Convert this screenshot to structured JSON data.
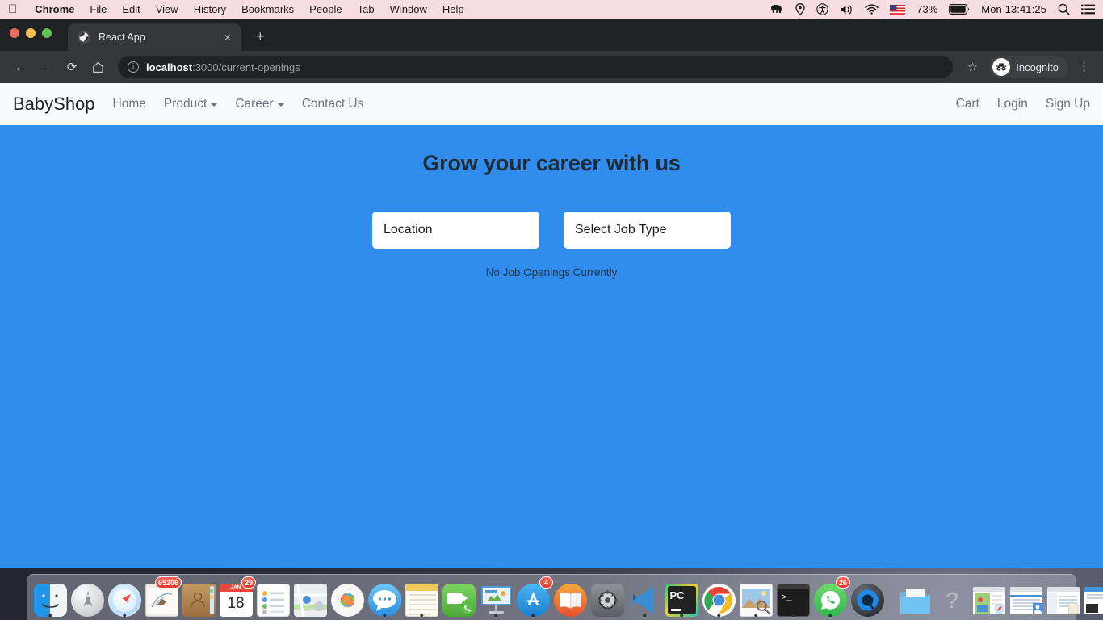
{
  "menubar": {
    "apple_icon": "apple-logo",
    "items": [
      {
        "label": "Chrome",
        "bold": true
      },
      {
        "label": "File",
        "bold": false
      },
      {
        "label": "Edit",
        "bold": false
      },
      {
        "label": "View",
        "bold": false
      },
      {
        "label": "History",
        "bold": false
      },
      {
        "label": "Bookmarks",
        "bold": false
      },
      {
        "label": "People",
        "bold": false
      },
      {
        "label": "Tab",
        "bold": false
      },
      {
        "label": "Window",
        "bold": false
      },
      {
        "label": "Help",
        "bold": false
      }
    ],
    "status_icons": [
      "elephant-icon",
      "location-pin-icon",
      "accessibility-icon",
      "volume-icon",
      "wifi-icon",
      "us-flag-icon"
    ],
    "battery_percent": "73%",
    "battery_icon": "battery-icon",
    "clock": "Mon 13:41:25",
    "spotlight_icon": "search-icon",
    "control_center_icon": "list-menu-icon",
    "background_color": "#f6dde3"
  },
  "browser": {
    "window_controls": [
      "close-button",
      "minimize-button",
      "maximize-button"
    ],
    "tab": {
      "title": "React App",
      "favicon": "globe-icon",
      "close_label": "×"
    },
    "new_tab_label": "+",
    "toolbar": {
      "back_label": "←",
      "forward_label": "→",
      "reload_label": "⟳",
      "home_label": "⌂",
      "site_info_label": "i",
      "url_host": "localhost",
      "url_rest": ":3000/current-openings",
      "bookmark_label": "☆",
      "profile_label": "Incognito",
      "profile_icon": "incognito-icon",
      "menu_label": "⋮"
    }
  },
  "page": {
    "navbar": {
      "brand": "BabyShop",
      "links": [
        {
          "label": "Home",
          "caret": false
        },
        {
          "label": "Product",
          "caret": true
        },
        {
          "label": "Career",
          "caret": true
        },
        {
          "label": "Contact Us",
          "caret": false
        }
      ],
      "right_links": [
        {
          "label": "Cart"
        },
        {
          "label": "Login"
        },
        {
          "label": "Sign Up"
        }
      ],
      "background_color": "#f8f9fa"
    },
    "hero": {
      "title": "Grow your career with us",
      "background_color": "#318ded",
      "filters": [
        {
          "name": "location",
          "value": "Location"
        },
        {
          "name": "job-type",
          "value": "Select Job Type"
        }
      ],
      "empty_message": "No Job Openings Currently"
    }
  },
  "dock": {
    "items": [
      {
        "name": "finder",
        "badge": "",
        "running": true
      },
      {
        "name": "launchpad",
        "badge": "",
        "running": false
      },
      {
        "name": "safari",
        "badge": "",
        "running": true
      },
      {
        "name": "mail",
        "badge": "65206",
        "running": true
      },
      {
        "name": "contacts",
        "badge": "",
        "running": false
      },
      {
        "name": "calendar",
        "badge": "29",
        "running": false
      },
      {
        "name": "reminders",
        "badge": "",
        "running": false
      },
      {
        "name": "maps",
        "badge": "",
        "running": false
      },
      {
        "name": "photos",
        "badge": "",
        "running": false
      },
      {
        "name": "messages",
        "badge": "",
        "running": true
      },
      {
        "name": "notes",
        "badge": "",
        "running": true
      },
      {
        "name": "facetime",
        "badge": "",
        "running": false
      },
      {
        "name": "keynote",
        "badge": "",
        "running": true
      },
      {
        "name": "app-store",
        "badge": "4",
        "running": true
      },
      {
        "name": "ibooks",
        "badge": "",
        "running": false
      },
      {
        "name": "system-preferences",
        "badge": "",
        "running": false
      },
      {
        "name": "vscode",
        "badge": "",
        "running": true
      },
      {
        "name": "pycharm",
        "badge": "",
        "running": true
      },
      {
        "name": "chrome",
        "badge": "",
        "running": true
      },
      {
        "name": "preview",
        "badge": "",
        "running": true
      },
      {
        "name": "terminal",
        "badge": "",
        "running": true
      },
      {
        "name": "whatsapp",
        "badge": "26",
        "running": true
      },
      {
        "name": "quicktime",
        "badge": "",
        "running": true
      }
    ],
    "calendar_month": "JAN",
    "calendar_day": "18",
    "pycharm_label": "PC",
    "help_label": "?",
    "right_items": [
      "downloads-folder",
      "help-icon",
      "minimized-window",
      "minimized-window",
      "minimized-window",
      "minimized-window",
      "minimized-window",
      "trash"
    ]
  }
}
